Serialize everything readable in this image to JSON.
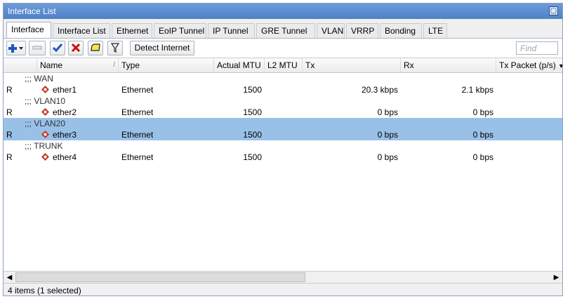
{
  "window": {
    "title": "Interface List"
  },
  "tabs": [
    {
      "label": "Interface",
      "active": true
    },
    {
      "label": "Interface List"
    },
    {
      "label": "Ethernet"
    },
    {
      "label": "EoIP Tunnel"
    },
    {
      "label": "IP Tunnel"
    },
    {
      "label": "GRE Tunnel"
    },
    {
      "label": "VLAN"
    },
    {
      "label": "VRRP"
    },
    {
      "label": "Bonding"
    },
    {
      "label": "LTE"
    }
  ],
  "toolbar": {
    "add_icon": "plus-icon",
    "detect_label": "Detect Internet",
    "find_placeholder": "Find"
  },
  "columns": {
    "name": "Name",
    "type": "Type",
    "actual_mtu": "Actual MTU",
    "l2_mtu": "L2 MTU",
    "tx": "Tx",
    "rx": "Rx",
    "tx_pps": "Tx Packet (p/s)"
  },
  "groups": [
    {
      "comment": ";;; WAN",
      "flag": "R",
      "name": "ether1",
      "type": "Ethernet",
      "actual_mtu": "1500",
      "l2_mtu": "",
      "tx": "20.3 kbps",
      "rx": "2.1 kbps",
      "selected": false
    },
    {
      "comment": ";;; VLAN10",
      "flag": "R",
      "name": "ether2",
      "type": "Ethernet",
      "actual_mtu": "1500",
      "l2_mtu": "",
      "tx": "0 bps",
      "rx": "0 bps",
      "selected": false
    },
    {
      "comment": ";;; VLAN20",
      "flag": "R",
      "name": "ether3",
      "type": "Ethernet",
      "actual_mtu": "1500",
      "l2_mtu": "",
      "tx": "0 bps",
      "rx": "0 bps",
      "selected": true
    },
    {
      "comment": ";;; TRUNK",
      "flag": "R",
      "name": "ether4",
      "type": "Ethernet",
      "actual_mtu": "1500",
      "l2_mtu": "",
      "tx": "0 bps",
      "rx": "0 bps",
      "selected": false
    }
  ],
  "status": {
    "text": "4 items (1 selected)"
  },
  "colors": {
    "selection": "#99c1e8",
    "titlebar": "#4f81c7",
    "add_icon": "#1f56c4",
    "remove_icon": "#d01010",
    "check_icon": "#1f56c4"
  }
}
